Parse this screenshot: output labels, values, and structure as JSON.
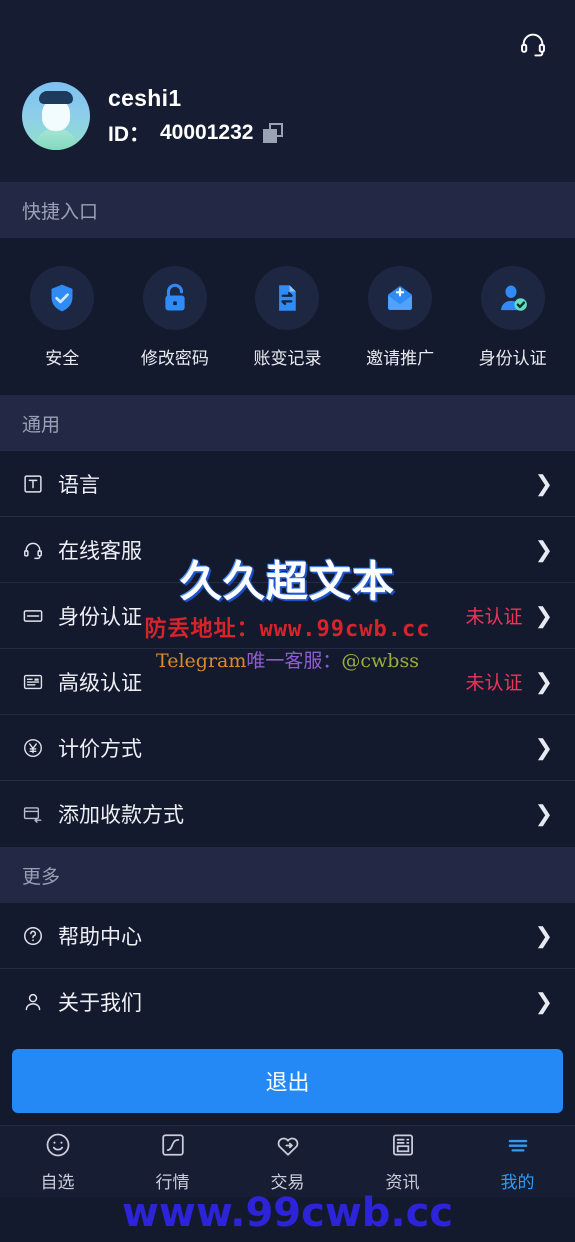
{
  "header": {
    "support_icon": "headset-icon",
    "username": "ceshi1",
    "id_label": "ID：",
    "id_value": "40001232",
    "copy_icon": "copy-icon"
  },
  "quick_entry": {
    "section_title": "快捷入口",
    "items": [
      {
        "label": "安全",
        "icon": "shield-check-icon"
      },
      {
        "label": "修改密码",
        "icon": "lock-icon"
      },
      {
        "label": "账变记录",
        "icon": "document-transfer-icon"
      },
      {
        "label": "邀请推广",
        "icon": "envelope-plus-icon"
      },
      {
        "label": "身份认证",
        "icon": "user-verified-icon"
      }
    ]
  },
  "general": {
    "section_title": "通用",
    "rows": [
      {
        "label": "语言",
        "icon": "translate-icon",
        "value": "",
        "status": ""
      },
      {
        "label": "在线客服",
        "icon": "headset-icon",
        "value": "",
        "status": ""
      },
      {
        "label": "身份认证",
        "icon": "id-card-icon",
        "value": "未认证",
        "status": "warn"
      },
      {
        "label": "高级认证",
        "icon": "document-id-icon",
        "value": "未认证",
        "status": "warn"
      },
      {
        "label": "计价方式",
        "icon": "yuan-circle-icon",
        "value": "",
        "status": ""
      },
      {
        "label": "添加收款方式",
        "icon": "add-payment-icon",
        "value": "",
        "status": ""
      }
    ]
  },
  "more": {
    "section_title": "更多",
    "rows": [
      {
        "label": "帮助中心",
        "icon": "question-circle-icon",
        "value": "",
        "status": ""
      },
      {
        "label": "关于我们",
        "icon": "person-icon",
        "value": "",
        "status": ""
      }
    ]
  },
  "logout": {
    "label": "退出"
  },
  "tabbar": {
    "items": [
      {
        "label": "自选",
        "icon": "smiley-icon",
        "active": false
      },
      {
        "label": "行情",
        "icon": "chart-square-icon",
        "active": false
      },
      {
        "label": "交易",
        "icon": "heart-swap-icon",
        "active": false
      },
      {
        "label": "资讯",
        "icon": "newspaper-icon",
        "active": false
      },
      {
        "label": "我的",
        "icon": "menu-lines-icon",
        "active": true
      }
    ]
  },
  "watermark": {
    "title": "久久超文本",
    "url_line": "防丢地址：www.99cwb.cc",
    "telegram_prefix": "Telegram",
    "telegram_mid": "唯一客服：",
    "telegram_handle": "@cwbss",
    "bottom_url": "www.99cwb.cc"
  },
  "colors": {
    "accent": "#2489f5",
    "warn": "#f0335a",
    "bg": "#141a2e",
    "section_bg": "#232845",
    "icon_blue": "#2f8bf5"
  }
}
